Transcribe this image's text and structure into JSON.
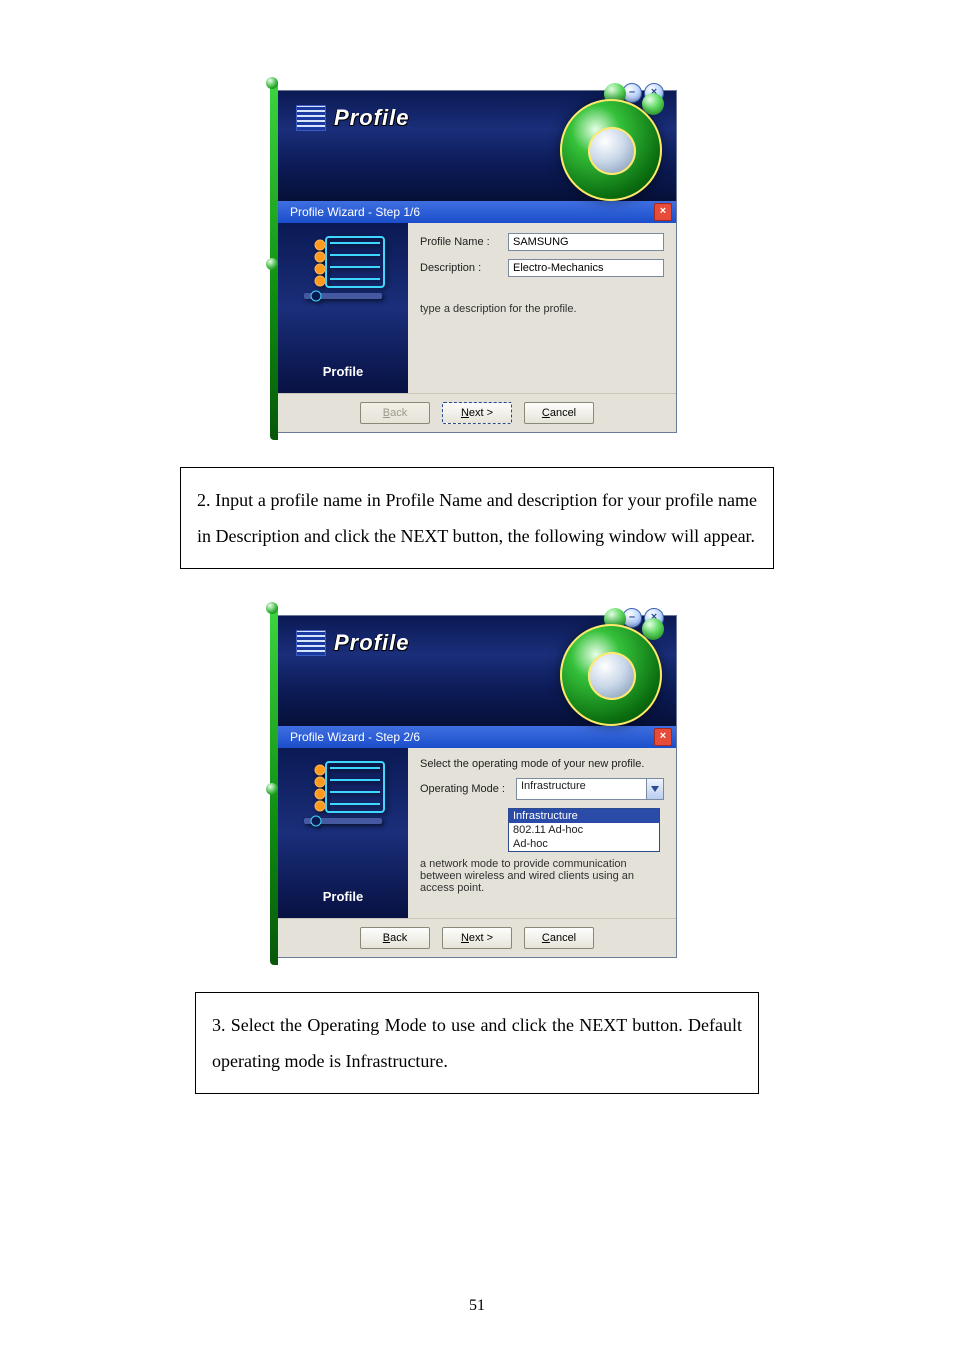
{
  "page_number": "51",
  "figure1": {
    "banner_title": "Profile",
    "step_title": "Profile Wizard - Step 1/6",
    "side_label": "Profile",
    "minimize_glyph": "–",
    "close_glyph": "×",
    "labels": {
      "profile_name": "Profile Name :",
      "description": "Description :"
    },
    "values": {
      "profile_name": "SAMSUNG",
      "description": "Electro-Mechanics"
    },
    "help_text": "type a description for the profile.",
    "buttons": {
      "back_u": "B",
      "back_rest": "ack",
      "next_u": "N",
      "next_rest": "ext >",
      "cancel_u": "C",
      "cancel_rest": "ancel"
    }
  },
  "instruction1": "2. Input a profile name in Profile Name and description for your profile name in Description and click the NEXT button, the following window will appear.",
  "figure2": {
    "banner_title": "Profile",
    "step_title": "Profile Wizard - Step 2/6",
    "side_label": "Profile",
    "minimize_glyph": "–",
    "close_glyph": "×",
    "intro_text": "Select the operating mode of your new profile.",
    "labels": {
      "operating_mode": "Operating Mode :"
    },
    "values": {
      "operating_mode": "Infrastructure"
    },
    "dropdown": {
      "options": [
        "Infrastructure",
        "802.11 Ad-hoc",
        "Ad-hoc"
      ],
      "selected_index": 0
    },
    "help_text": "a network mode to provide communication between wireless and wired clients using an access point.",
    "buttons": {
      "back_u": "B",
      "back_rest": "ack",
      "next_u": "N",
      "next_rest": "ext >",
      "cancel_u": "C",
      "cancel_rest": "ancel"
    }
  },
  "instruction2": "3. Select the Operating Mode to use and click the NEXT button. Default operating mode is Infrastructure."
}
